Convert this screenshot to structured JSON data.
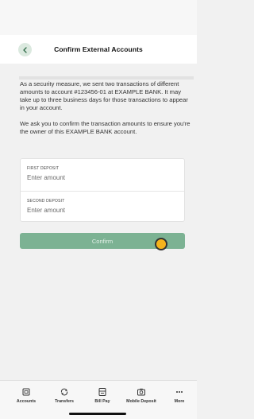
{
  "header": {
    "title": "Confirm External Accounts"
  },
  "message": {
    "paragraph1": "As a security measure, we sent two transactions of different amounts to account #123456-01 at EXAMPLE BANK. It may take up to three business days for those transactions to appear in your account.",
    "paragraph2": "We ask you to confirm the transaction amounts to ensure you're the owner of this EXAMPLE BANK account."
  },
  "form": {
    "first_deposit": {
      "label": "FIRST DEPOSIT",
      "placeholder": "Enter amount"
    },
    "second_deposit": {
      "label": "SECOND DEPOSIT",
      "placeholder": "Enter amount"
    },
    "confirm_label": "Confirm"
  },
  "nav": {
    "items": [
      {
        "label": "Accounts",
        "icon": "accounts-icon"
      },
      {
        "label": "Transfers",
        "icon": "transfers-icon"
      },
      {
        "label": "Bill Pay",
        "icon": "bill-pay-icon"
      },
      {
        "label": "Mobile Deposit",
        "icon": "camera-icon"
      },
      {
        "label": "More",
        "icon": "more-icon"
      }
    ]
  },
  "colors": {
    "accent": "#7cb293",
    "back_button_bg": "#dbe9df",
    "cursor": "#f5b31c"
  }
}
